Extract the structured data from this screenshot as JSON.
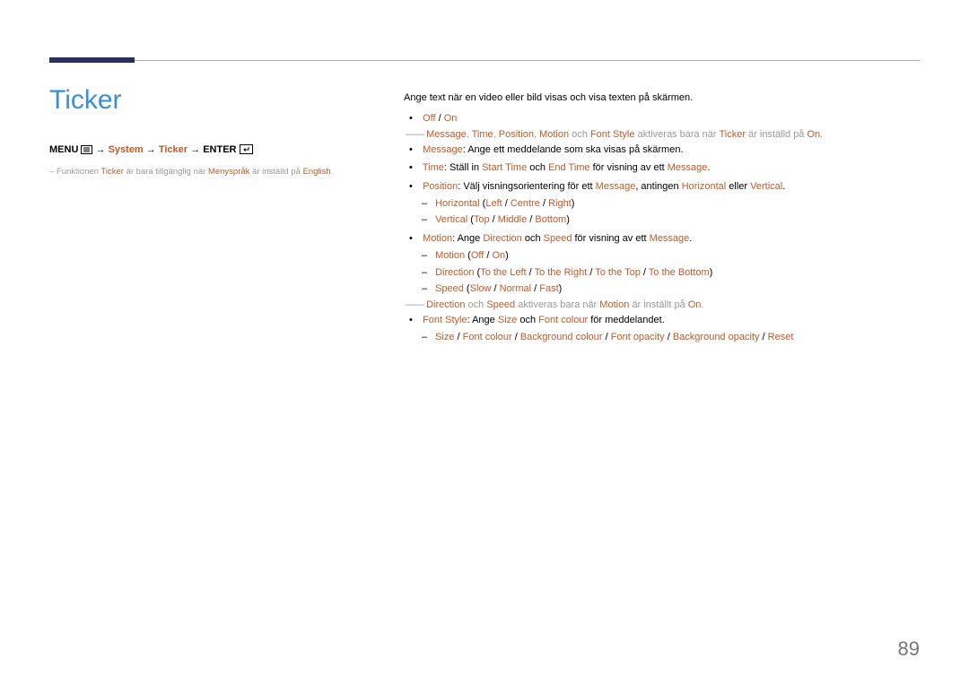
{
  "title": "Ticker",
  "breadcrumb": {
    "menu": "MENU",
    "system": "System",
    "ticker": "Ticker",
    "enter": "ENTER"
  },
  "left_footnote": {
    "pre": "Funktionen ",
    "kw1": "Ticker",
    "mid": " är bara tillgänglig när ",
    "kw2": "Menyspråk",
    "mid2": " är inställd på ",
    "kw3": "English",
    "post": "."
  },
  "intro": "Ange text när en video eller bild visas och visa texten på skärmen.",
  "offon": {
    "off": "Off",
    "on": "On"
  },
  "note1": {
    "kw_msg": "Message",
    "kw_time": "Time",
    "kw_pos": "Position",
    "kw_motion": "Motion",
    "och": " och ",
    "kw_fs": "Font Style",
    "txt": " aktiveras bara när ",
    "kw_ticker": "Ticker",
    "txt2": " är inställd på ",
    "kw_on": "On",
    "dot": "."
  },
  "message_line": {
    "kw": "Message",
    "txt": ": Ange ett meddelande som ska visas på skärmen."
  },
  "time_line": {
    "kw": "Time",
    "txt": ": Ställ in ",
    "kw_start": "Start Time",
    "och": " och ",
    "kw_end": "End Time",
    "txt2": " för visning av ett ",
    "kw_msg": "Message",
    "dot": "."
  },
  "position_line": {
    "kw": "Position",
    "txt": ": Välj visningsorientering för ett ",
    "kw_msg": "Message",
    "txt2": ", antingen ",
    "kw_h": "Horizontal",
    "eller": " eller ",
    "kw_v": "Vertical",
    "dot": "."
  },
  "horizontal_line": {
    "kw": "Horizontal",
    "l": "Left",
    "c": "Centre",
    "r": "Right"
  },
  "vertical_line": {
    "kw": "Vertical",
    "t": "Top",
    "m": "Middle",
    "b": "Bottom"
  },
  "motion_line": {
    "kw": "Motion",
    "txt": ": Ange ",
    "kw_dir": "Direction",
    "och": " och ",
    "kw_speed": "Speed",
    "txt2": " för visning av ett ",
    "kw_msg": "Message",
    "dot": "."
  },
  "motion_sub": {
    "kw": "Motion",
    "off": "Off",
    "on": "On"
  },
  "direction_sub": {
    "kw": "Direction",
    "l": "To the Left",
    "r": "To the Right",
    "t": "To the Top",
    "b": "To the Bottom"
  },
  "speed_sub": {
    "kw": "Speed",
    "s": "Slow",
    "n": "Normal",
    "f": "Fast"
  },
  "note2": {
    "kw_dir": "Direction",
    "och": " och ",
    "kw_speed": "Speed",
    "txt": " aktiveras bara när ",
    "kw_motion": "Motion",
    "txt2": " är inställt på ",
    "kw_on": "On",
    "dot": "."
  },
  "fontstyle_line": {
    "kw": "Font Style",
    "txt": ": Ange ",
    "kw_size": "Size",
    "och": " och ",
    "kw_fc": "Font colour",
    "txt2": " för meddelandet."
  },
  "fontstyle_sub": {
    "size": "Size",
    "fc": "Font colour",
    "bc": "Background colour",
    "fo": "Font opacity",
    "bo": "Background opacity",
    "reset": "Reset"
  },
  "page_number": "89"
}
